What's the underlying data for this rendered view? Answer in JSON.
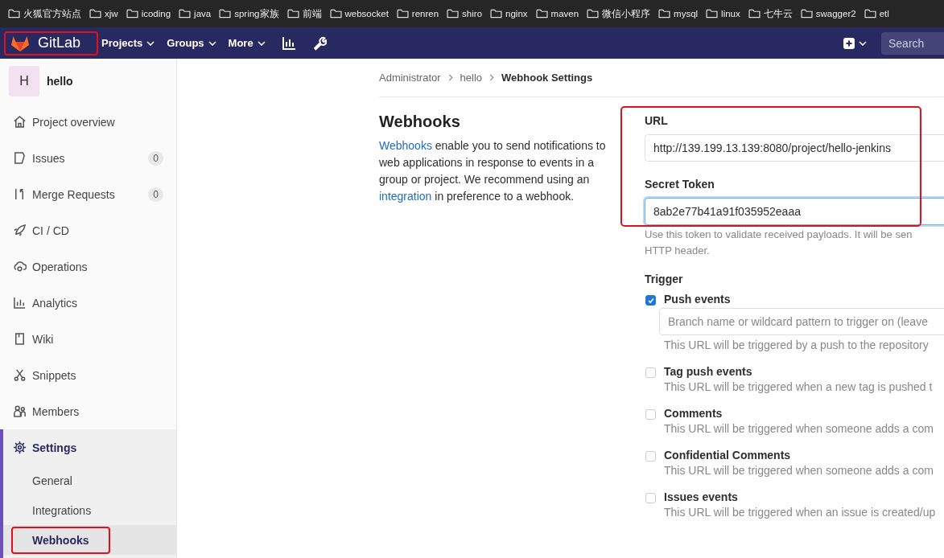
{
  "bookmarks": [
    "火狐官方站点",
    "xjw",
    "icoding",
    "java",
    "spring家族",
    "前端",
    "websocket",
    "renren",
    "shiro",
    "nginx",
    "maven",
    "微信小程序",
    "mysql",
    "linux",
    "七牛云",
    "swagger2",
    "etl"
  ],
  "navbar": {
    "brand": "GitLab",
    "brand_highlighted": true,
    "menus": [
      "Projects",
      "Groups",
      "More"
    ],
    "search": {
      "placeholder": "Search"
    }
  },
  "sidebar": {
    "project": {
      "avatar": "H",
      "name": "hello"
    },
    "items": [
      {
        "label": "Project overview",
        "kind": "home",
        "selected": false
      },
      {
        "label": "Issues",
        "kind": "issues",
        "count": "0",
        "selected": false
      },
      {
        "label": "Merge Requests",
        "kind": "merge",
        "count": "0",
        "selected": false
      },
      {
        "label": "CI / CD",
        "kind": "rocket",
        "selected": false
      },
      {
        "label": "Operations",
        "kind": "cloud",
        "selected": false
      },
      {
        "label": "Analytics",
        "kind": "chart",
        "selected": false
      },
      {
        "label": "Wiki",
        "kind": "book",
        "selected": false
      },
      {
        "label": "Snippets",
        "kind": "scissors",
        "selected": false
      },
      {
        "label": "Members",
        "kind": "users",
        "selected": false
      },
      {
        "label": "Settings",
        "kind": "gear",
        "selected": true,
        "children": [
          {
            "label": "General",
            "selected": false,
            "highlighted": false
          },
          {
            "label": "Integrations",
            "selected": false,
            "highlighted": false
          },
          {
            "label": "Webhooks",
            "selected": true,
            "highlighted": true
          }
        ]
      }
    ]
  },
  "breadcrumb": [
    "Administrator",
    "hello",
    "Webhook Settings"
  ],
  "intro": {
    "title": "Webhooks",
    "text": "enable you to send notifications to web applications in response to events in a group or project. We recommend using an",
    "link1": "Webhooks",
    "link2": "integration",
    "text2": "in preference to a webhook."
  },
  "form": {
    "highlighted": true,
    "url": {
      "label": "URL",
      "value": "http://139.199.13.139:8080/project/hello-jenkins"
    },
    "token": {
      "label": "Secret Token",
      "value": "8ab2e77b41a91f035952eaaa",
      "focused": true,
      "help": "Use this token to validate received payloads. It will be sen",
      "help2": "HTTP header."
    },
    "trigger_label": "Trigger",
    "triggers": [
      {
        "label": "Push events",
        "checked": true,
        "branch_placeholder": "Branch name or wildcard pattern to trigger on (leave",
        "description": "This URL will be triggered by a push to the repository"
      },
      {
        "label": "Tag push events",
        "checked": false,
        "description": "This URL will be triggered when a new tag is pushed t"
      },
      {
        "label": "Comments",
        "checked": false,
        "description": "This URL will be triggered when someone adds a com"
      },
      {
        "label": "Confidential Comments",
        "checked": false,
        "description": "This URL will be triggered when someone adds a com"
      },
      {
        "label": "Issues events",
        "checked": false,
        "description": "This URL will be triggered when an issue is created/up"
      }
    ]
  }
}
